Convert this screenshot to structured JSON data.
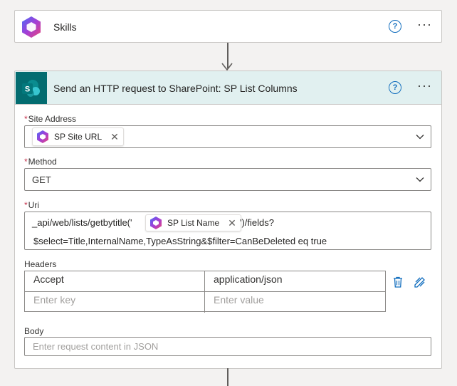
{
  "skills_card": {
    "title": "Skills",
    "help_label": "?",
    "more_label": "···"
  },
  "http_card": {
    "title": "Send an HTTP request to SharePoint: SP List Columns",
    "help_label": "?",
    "more_label": "···",
    "site_address": {
      "label": "Site Address",
      "required_mark": "*",
      "token_label": "SP Site URL",
      "token_close": "✕"
    },
    "method": {
      "label": "Method",
      "required_mark": "*",
      "value": "GET"
    },
    "uri": {
      "label": "Uri",
      "required_mark": "*",
      "line1_prefix": "_api/web/lists/getbytitle('",
      "token_label": "SP List Name",
      "token_close": "✕",
      "line1_suffix": "')/fields?",
      "line2": "$select=Title,InternalName,TypeAsString&$filter=CanBeDeleted eq true"
    },
    "headers": {
      "label": "Headers",
      "rows": [
        {
          "key": "Accept",
          "value": "application/json"
        }
      ],
      "key_placeholder": "Enter key",
      "value_placeholder": "Enter value"
    },
    "body": {
      "label": "Body",
      "placeholder": "Enter request content in JSON"
    }
  },
  "icons": {
    "skills_app": "m365-copilot-icon",
    "sharepoint": "sharepoint-icon",
    "delete": "trash-icon",
    "switch_mode": "switch-to-text-mode-icon"
  },
  "colors": {
    "accent": "#0f6cbd",
    "header_band": "#e1f0f0",
    "sharepoint_teal": "#036c70",
    "required": "#c4314b"
  }
}
